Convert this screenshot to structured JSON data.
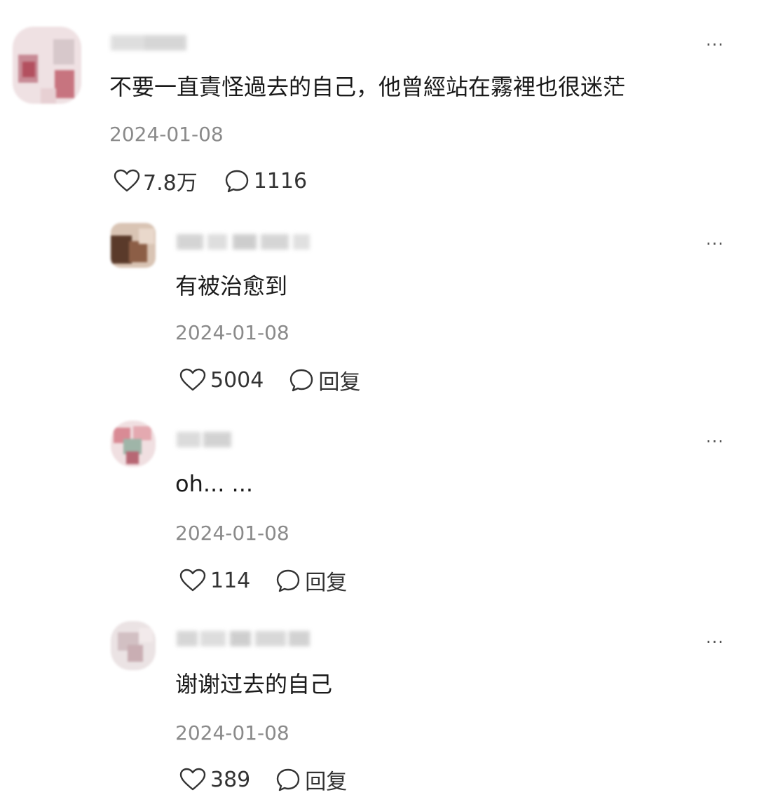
{
  "comments": [
    {
      "text": "不要一直責怪過去的自己，他曾經站在霧裡也很迷茫",
      "date": "2024-01-08",
      "likes": "7.8万",
      "replies": "1116",
      "more": "···"
    },
    {
      "text": "有被治愈到",
      "date": "2024-01-08",
      "likes": "5004",
      "reply_label": "回复",
      "more": "···"
    },
    {
      "text": "oh... ...",
      "date": "2024-01-08",
      "likes": "114",
      "reply_label": "回复",
      "more": "···"
    },
    {
      "text": "谢谢过去的自己",
      "date": "2024-01-08",
      "likes": "389",
      "reply_label": "回复",
      "more": "···"
    }
  ],
  "icons": {
    "like": "heart-outline-icon",
    "reply": "speech-bubble-icon",
    "more": "more-dots-icon"
  },
  "colors": {
    "text": "#1a1a1a",
    "meta": "#8a8a8a",
    "icon": "#333333"
  }
}
